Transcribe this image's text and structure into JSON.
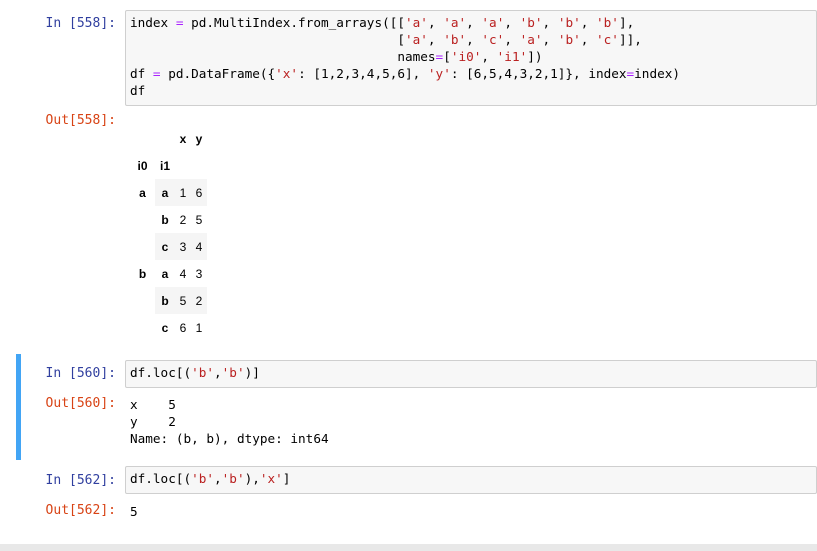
{
  "cells": [
    {
      "in_prompt": "In [558]:",
      "code_lines": [
        "index = pd.MultiIndex.from_arrays([['a', 'a', 'a', 'b', 'b', 'b'],",
        "                                   ['a', 'b', 'c', 'a', 'b', 'c']],",
        "                                   names=['i0', 'i1'])",
        "df = pd.DataFrame({'x': [1,2,3,4,5,6], 'y': [6,5,4,3,2,1]}, index=index)",
        "df"
      ],
      "out_prompt": "Out[558]:",
      "table": {
        "columns": [
          "x",
          "y"
        ],
        "index_names": [
          "i0",
          "i1"
        ],
        "rows": [
          {
            "i0": "a",
            "i1": "a",
            "x": "1",
            "y": "6"
          },
          {
            "i0": "",
            "i1": "b",
            "x": "2",
            "y": "5"
          },
          {
            "i0": "",
            "i1": "c",
            "x": "3",
            "y": "4"
          },
          {
            "i0": "b",
            "i1": "a",
            "x": "4",
            "y": "3"
          },
          {
            "i0": "",
            "i1": "b",
            "x": "5",
            "y": "2"
          },
          {
            "i0": "",
            "i1": "c",
            "x": "6",
            "y": "1"
          }
        ]
      }
    },
    {
      "in_prompt": "In [560]:",
      "code_lines": [
        "df.loc[('b','b')]"
      ],
      "out_prompt": "Out[560]:",
      "output_lines": [
        "x    5",
        "y    2",
        "Name: (b, b), dtype: int64"
      ]
    },
    {
      "in_prompt": "In [562]:",
      "code_lines": [
        "df.loc[('b','b'),'x']"
      ],
      "out_prompt": "Out[562]:",
      "output_lines": [
        "5"
      ]
    }
  ],
  "colors": {
    "in_prompt": "#303f9f",
    "out_prompt": "#d84315",
    "string": "#ba2121",
    "operator": "#aa22ff",
    "selected_border": "#42a5f5"
  }
}
